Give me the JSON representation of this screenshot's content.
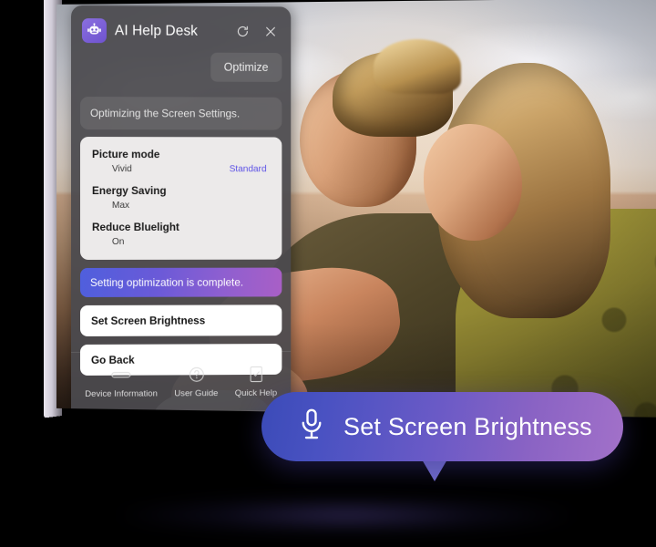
{
  "app": {
    "title": "AI Help Desk",
    "logo_icon": "robot-face-icon",
    "refresh_icon": "refresh-icon",
    "close_icon": "close-icon"
  },
  "toolbar": {
    "optimize_label": "Optimize"
  },
  "status": {
    "message": "Optimizing the Screen Settings."
  },
  "settings": {
    "items": [
      {
        "name": "Picture mode",
        "old_value": "Vivid",
        "new_value": "Standard"
      },
      {
        "name": "Energy Saving",
        "old_value": "Max",
        "new_value": ""
      },
      {
        "name": "Reduce Bluelight",
        "old_value": "On",
        "new_value": ""
      }
    ]
  },
  "banner": {
    "message": "Setting optimization is complete."
  },
  "actions": [
    {
      "label": "Set Screen Brightness"
    },
    {
      "label": "Go Back"
    }
  ],
  "footer": {
    "items": [
      {
        "label": "Device Information",
        "icon": "remote-control-icon"
      },
      {
        "label": "User Guide",
        "icon": "question-circle-icon"
      },
      {
        "label": "Quick Help",
        "icon": "document-check-icon"
      }
    ]
  },
  "voice": {
    "command": "Set Screen Brightness",
    "icon": "microphone-icon"
  },
  "colors": {
    "accent_purple": "#6f53cf",
    "accent_blue": "#4f5fdd",
    "link_purple": "#5b50e6",
    "panel_bg": "#4a494e",
    "card_bg": "#eceaea"
  }
}
